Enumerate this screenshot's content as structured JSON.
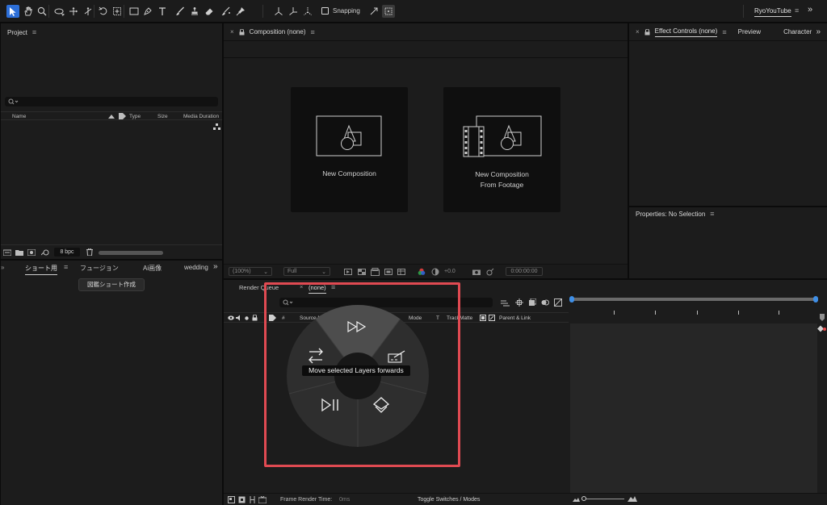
{
  "toolbar": {
    "snapping_label": "Snapping",
    "workspace_label": "RyoYouTube",
    "tools": [
      "selection-tool-icon",
      "hand-tool-icon",
      "zoom-tool-icon",
      "orbit-camera-icon",
      "pan-camera-icon",
      "dolly-camera-icon",
      "rotate-tool-icon",
      "pan-behind-icon",
      "rectangle-tool-icon",
      "pen-tool-icon",
      "type-tool-icon",
      "brush-tool-icon",
      "clone-stamp-icon",
      "eraser-tool-icon",
      "roto-brush-icon",
      "puppet-pin-icon"
    ]
  },
  "project": {
    "title": "Project",
    "columns": {
      "name": "Name",
      "type": "Type",
      "size": "Size",
      "duration": "Media Duration"
    },
    "bpc_label": "8 bpc"
  },
  "plugin_panel": {
    "tabs": [
      "ショート用",
      "フュージョン",
      "Ai画像",
      "wedding"
    ],
    "button_label": "図鑑ショート作成"
  },
  "composition": {
    "title": "Composition (none)",
    "new_comp_label": "New Composition",
    "new_comp_footage_line1": "New Composition",
    "new_comp_footage_line2": "From Footage",
    "zoom_value": "(100%)",
    "resolution_value": "Full",
    "exposure_value": "+0.0",
    "timecode": "0:00:00:00"
  },
  "effect_controls": {
    "tabs": [
      "Effect Controls (none)",
      "Preview",
      "Character"
    ]
  },
  "properties": {
    "title": "Properties: No Selection"
  },
  "timeline": {
    "tabs": [
      "Render Queue",
      "(none)"
    ],
    "columns": {
      "source": "Source Name",
      "mode": "Mode",
      "t": "T",
      "track_matte": "TrackMatte",
      "parent": "Parent & Link",
      "hash": "#"
    },
    "frame_render_label": "Frame Render Time:",
    "frame_render_value": "0ms",
    "toggle_label": "Toggle Switches / Modes"
  },
  "radial_menu": {
    "tooltip": "Move selected Layers forwards",
    "items": [
      "fast-forward-icon",
      "swap-arrows-icon",
      "keyframe-edit-icon",
      "play-pause-icon",
      "layers-icon"
    ]
  },
  "colors": {
    "accent": "#2d8ceb",
    "highlight": "#e04a52",
    "panel": "#1c1c1c"
  }
}
